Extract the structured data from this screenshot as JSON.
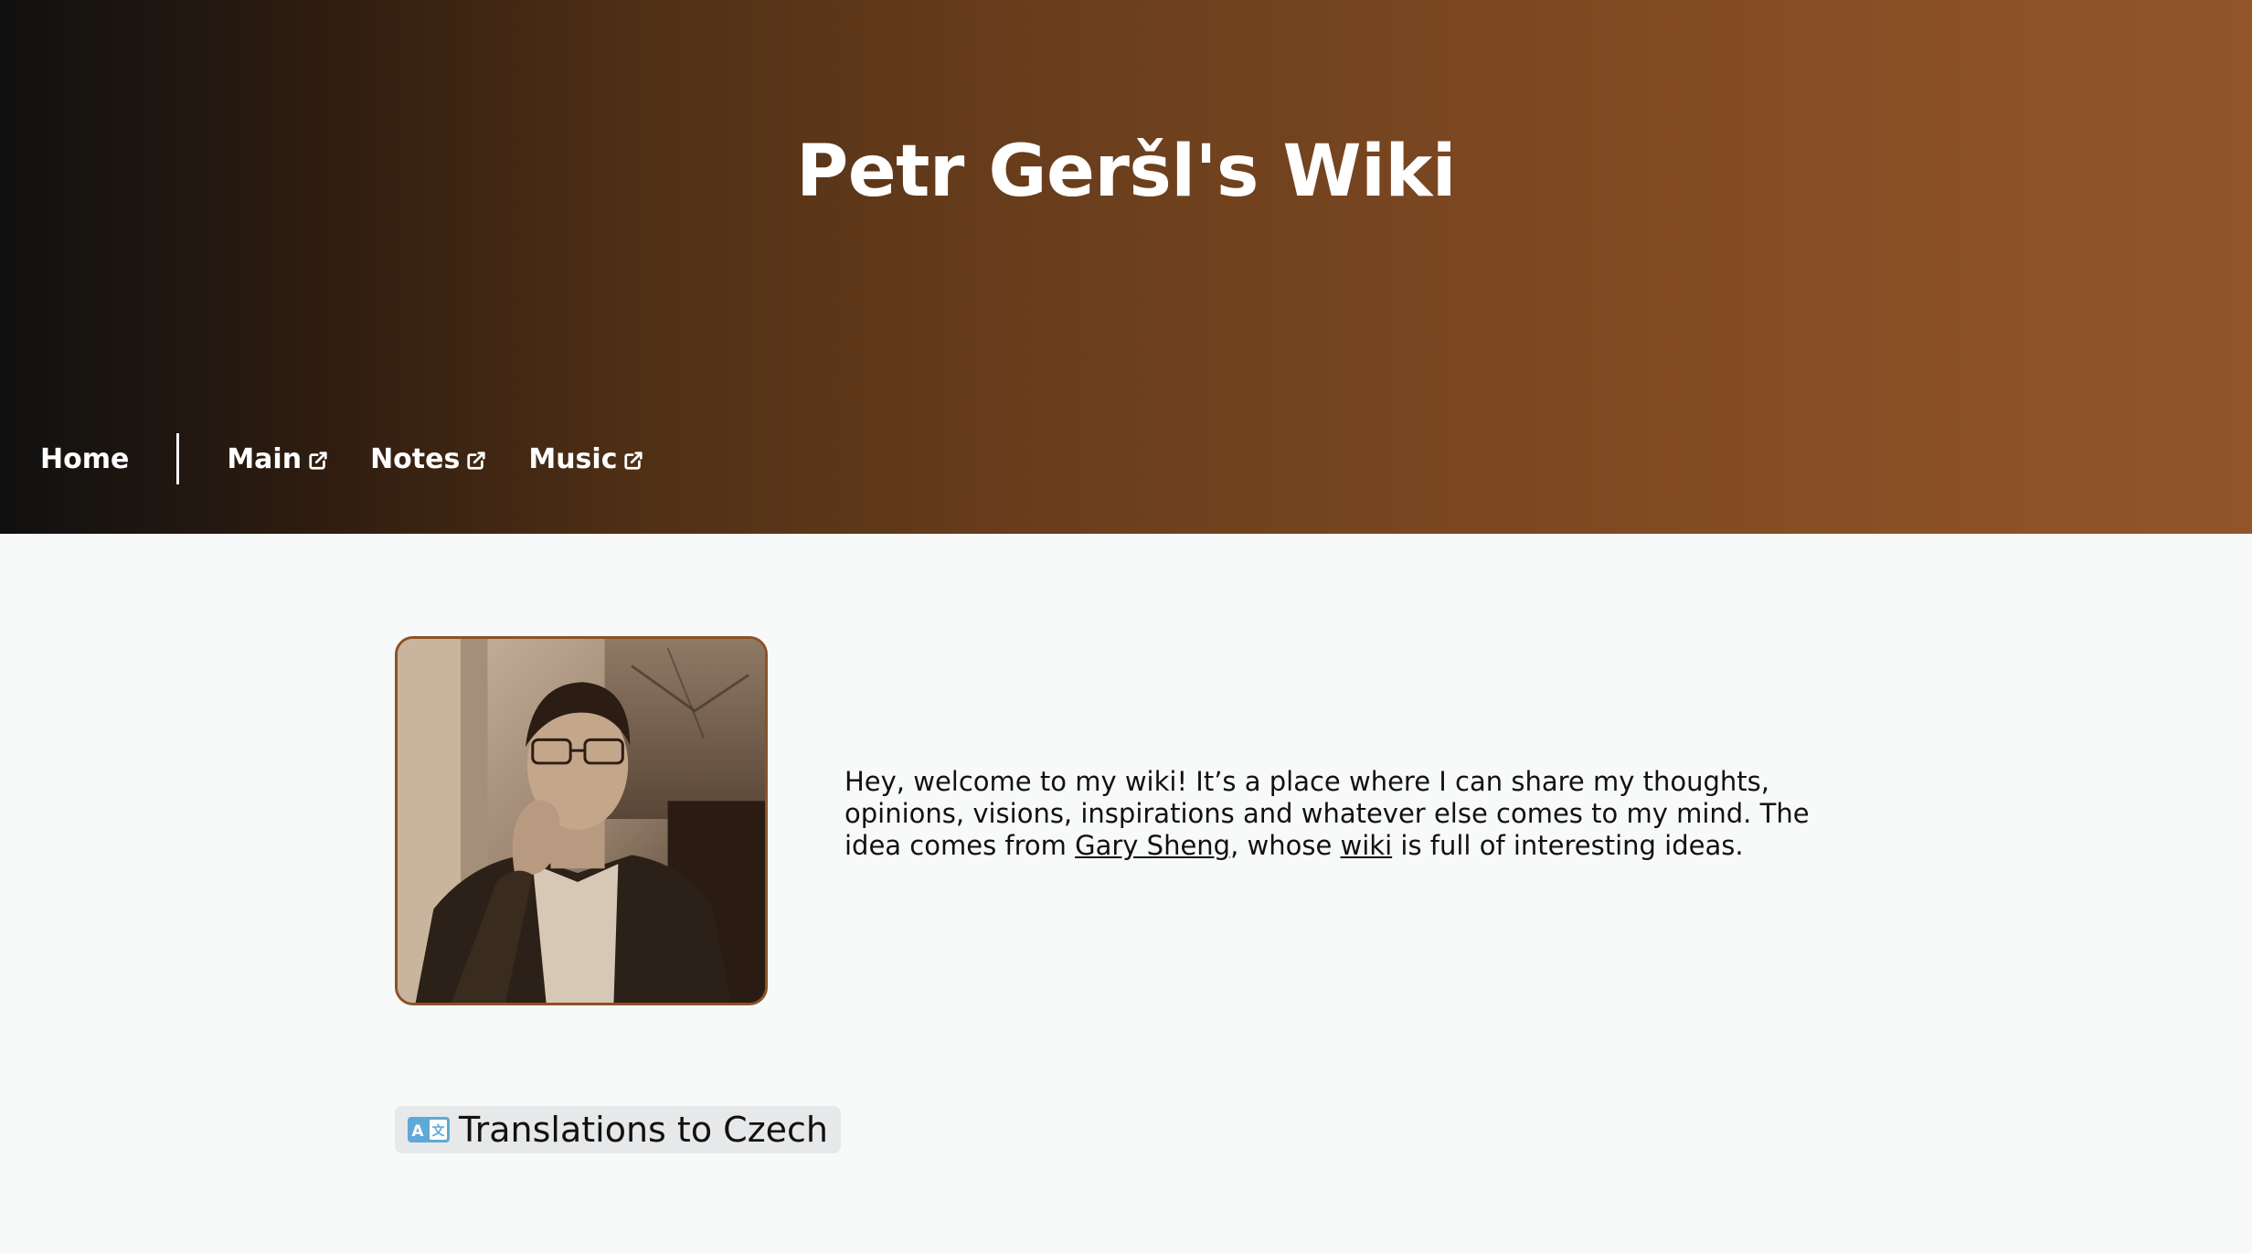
{
  "header": {
    "title": "Petr Geršl's Wiki",
    "gradient_start": "#101010",
    "gradient_end": "#92552a"
  },
  "nav": {
    "home": "Home",
    "main": "Main",
    "notes": "Notes",
    "music": "Music",
    "external_icon": "external-link-icon"
  },
  "content": {
    "photo_alt": "Portrait photo",
    "intro_part1": "Hey, welcome to my wiki! It’s a place where I can share my thoughts, opinions, visions, inspirations and whatever else comes to my mind. The idea comes from ",
    "link_gary": "Gary Sheng",
    "intro_part2": ", whose ",
    "link_wiki": "wiki",
    "intro_part3": " is full of interesting ideas.",
    "translations_label": "Translations to Czech",
    "translations_icon": "language-icon",
    "accent_color": "#8c5227",
    "background_color": "#f8f9f9"
  }
}
